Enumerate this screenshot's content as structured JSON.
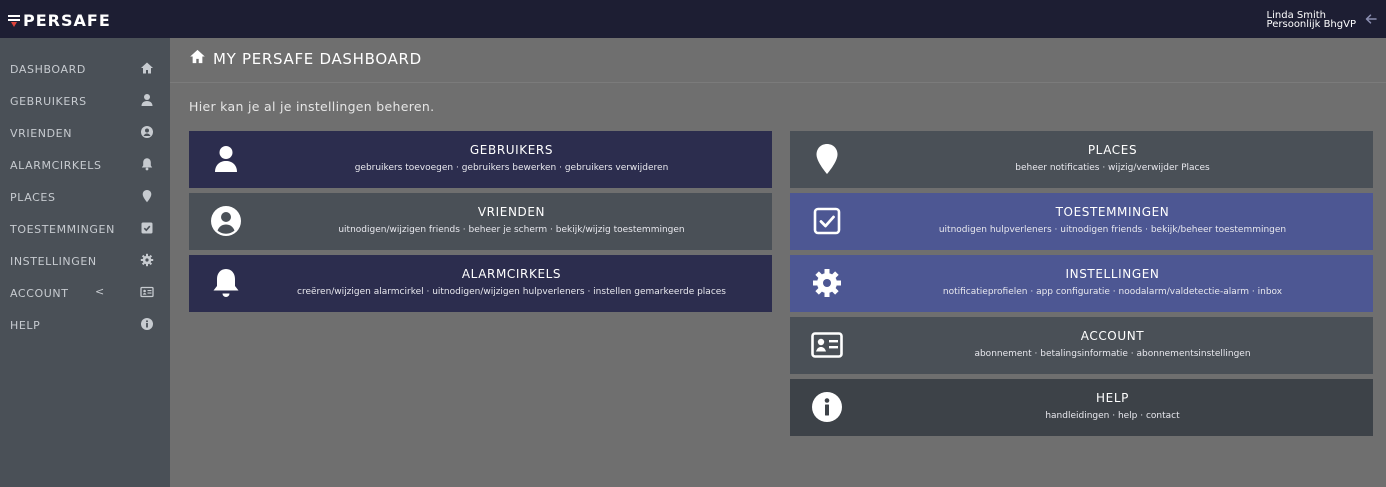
{
  "colors": {
    "topbar": "#1d1e33",
    "sidebar": "#4a5057",
    "content": "#6f6f6f",
    "card_dark": "#2c2d4e",
    "card_gray": "#4a5057",
    "card_blue": "#4d5793",
    "logo_accent": "#e0443c"
  },
  "app": {
    "logo_text": "PERSAFE"
  },
  "user": {
    "name": "Linda Smith",
    "profile": "Persoonlijk BhgVP",
    "logout_icon": "arrow-left-icon"
  },
  "sidebar": {
    "items": [
      {
        "label": "DASHBOARD",
        "icon": "home-icon"
      },
      {
        "label": "GEBRUIKERS",
        "icon": "user-icon"
      },
      {
        "label": "VRIENDEN",
        "icon": "user-circle-icon"
      },
      {
        "label": "ALARMCIRKELS",
        "icon": "bell-icon"
      },
      {
        "label": "PLACES",
        "icon": "map-marker-icon"
      },
      {
        "label": "TOESTEMMINGEN",
        "icon": "check-square-icon"
      },
      {
        "label": "INSTELLINGEN",
        "icon": "gear-icon"
      },
      {
        "label": "ACCOUNT",
        "icon": "id-card-icon",
        "chevron": "<"
      },
      {
        "label": "HELP",
        "icon": "info-circle-icon"
      }
    ]
  },
  "page": {
    "title": "MY PERSAFE DASHBOARD",
    "intro": "Hier kan je al je instellingen beheren."
  },
  "cards": {
    "left": [
      {
        "title": "GEBRUIKERS",
        "subtitle": "gebruikers toevoegen · gebruikers bewerken · gebruikers verwijderen",
        "icon": "user-icon",
        "color": "#2c2d4e"
      },
      {
        "title": "VRIENDEN",
        "subtitle": "uitnodigen/wijzigen friends · beheer je scherm · bekijk/wijzig toestemmingen",
        "icon": "user-circle-icon",
        "color": "#4a5057"
      },
      {
        "title": "ALARMCIRKELS",
        "subtitle": "creëren/wijzigen alarmcirkel · uitnodigen/wijzigen hulpverleners · instellen gemarkeerde places",
        "icon": "bell-icon",
        "color": "#2c2d4e"
      }
    ],
    "right": [
      {
        "title": "PLACES",
        "subtitle": "beheer notificaties · wijzig/verwijder Places",
        "icon": "map-marker-icon",
        "color": "#4a5057"
      },
      {
        "title": "TOESTEMMINGEN",
        "subtitle": "uitnodigen hulpverleners · uitnodigen friends · bekijk/beheer toestemmingen",
        "icon": "check-square-icon",
        "color": "#4d5793"
      },
      {
        "title": "INSTELLINGEN",
        "subtitle": "notificatieprofielen · app configuratie · noodalarm/valdetectie-alarm · inbox",
        "icon": "gear-icon",
        "color": "#4d5793"
      },
      {
        "title": "ACCOUNT",
        "subtitle": "abonnement · betalingsinformatie · abonnementsinstellingen",
        "icon": "id-card-icon",
        "color": "#4a5057"
      },
      {
        "title": "HELP",
        "subtitle": "handleidingen · help · contact",
        "icon": "info-circle-icon",
        "color": "#3d4248"
      }
    ]
  }
}
